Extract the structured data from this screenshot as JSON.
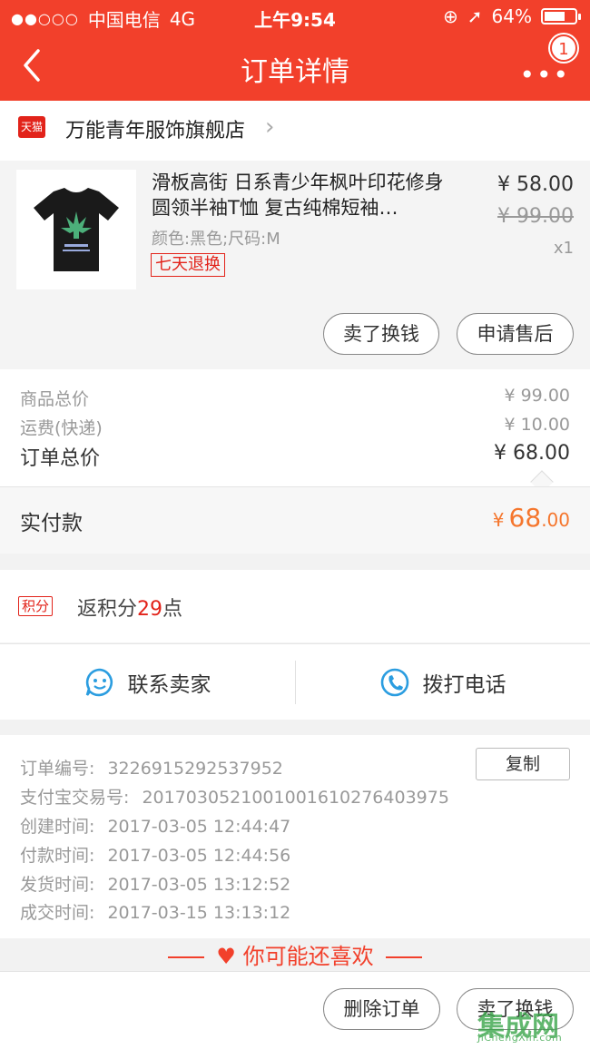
{
  "status_bar": {
    "carrier": "中国电信",
    "network": "4G",
    "time": "上午9:54",
    "battery": "64%"
  },
  "nav": {
    "title": "订单详情",
    "badge": "1"
  },
  "store": {
    "badge": "天猫",
    "name": "万能青年服饰旗舰店"
  },
  "item": {
    "title": "滑板高街 日系青少年枫叶印花修身圆领半袖T恤 复古纯棉短袖…",
    "sku": "颜色:黑色;尺码:M",
    "tag": "七天退换",
    "price": "¥ 58.00",
    "original_price": "¥ 99.00",
    "quantity": "x1",
    "actions": [
      "卖了换钱",
      "申请售后"
    ]
  },
  "totals": {
    "goods_label": "商品总价",
    "goods_value": "¥ 99.00",
    "shipping_label": "运费(快递)",
    "shipping_value": "¥ 10.00",
    "order_label": "订单总价",
    "order_value": "¥ 68.00"
  },
  "paid": {
    "label": "实付款",
    "currency": "¥",
    "int": "68",
    "dec": ".00"
  },
  "points": {
    "tag": "积分",
    "prefix": "返积分",
    "value": "29",
    "suffix": "点"
  },
  "contact": {
    "seller": "联系卖家",
    "call": "拨打电话"
  },
  "order_info": {
    "copy_button": "复制",
    "rows": [
      {
        "label": "订单编号:",
        "value": "3226915292537952"
      },
      {
        "label": "支付宝交易号:",
        "value": "2017030521001001610276403975"
      },
      {
        "label": "创建时间:",
        "value": "2017-03-05 12:44:47"
      },
      {
        "label": "付款时间:",
        "value": "2017-03-05 12:44:56"
      },
      {
        "label": "发货时间:",
        "value": "2017-03-05 13:12:52"
      },
      {
        "label": "成交时间:",
        "value": "2017-03-15 13:13:12"
      }
    ]
  },
  "recommend": {
    "title": "你可能还喜欢"
  },
  "footer": {
    "actions": [
      "删除订单",
      "卖了换钱"
    ]
  },
  "watermark": {
    "logo": "集成网",
    "url": "JiChengXin.com"
  },
  "colors": {
    "brand_red": "#f2402b",
    "price_orange": "#f5762d"
  }
}
